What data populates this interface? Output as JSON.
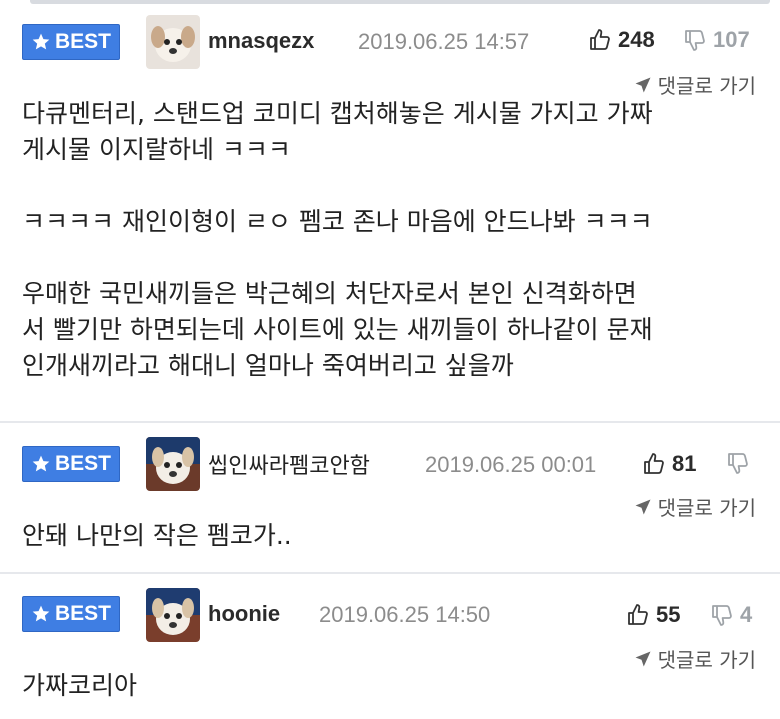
{
  "colors": {
    "best_badge": "#3f7ee3",
    "date": "#8c8c8c",
    "dislike": "#9ea3a8",
    "divider": "#e6e8ec"
  },
  "comments": [
    {
      "badge": "BEST",
      "nickname": "mnasqezx",
      "date": "2019.06.25 14:57",
      "likes": "248",
      "dislikes": "107",
      "reply_label": "댓글로 가기",
      "body": "다큐멘터리, 스탠드업 코미디 캡처해놓은 게시물 가지고 가짜\n게시물 이지랄하네 ㅋㅋㅋ\n\nㅋㅋㅋㅋ 재인이형이 ㄹㅇ 펨코 존나 마음에 안드나봐 ㅋㅋㅋ\n\n우매한 국민새끼들은 박근혜의 처단자로서 본인 신격화하면\n서 빨기만 하면되는데 사이트에 있는 새끼들이 하나같이 문재\n인개새끼라고 해대니 얼마나 죽여버리고 싶을까"
    },
    {
      "badge": "BEST",
      "nickname": "씹인싸라펨코안함",
      "date": "2019.06.25 00:01",
      "likes": "81",
      "dislikes": "",
      "reply_label": "댓글로 가기",
      "body": "안돼 나만의 작은 펨코가.."
    },
    {
      "badge": "BEST",
      "nickname": "hoonie",
      "date": "2019.06.25 14:50",
      "likes": "55",
      "dislikes": "4",
      "reply_label": "댓글로 가기",
      "body": "가짜코리아"
    }
  ]
}
